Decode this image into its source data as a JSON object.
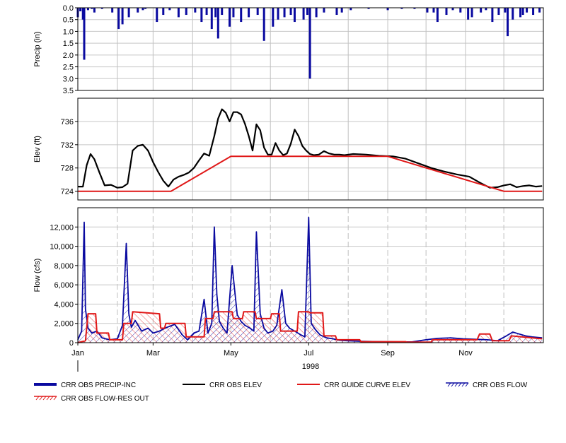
{
  "chart_data": [
    {
      "type": "bar",
      "panel": "precip",
      "ylabel": "Precip (in)",
      "ylim": [
        0,
        3.5
      ],
      "y_inverted": true,
      "y_ticks": [
        "0.0",
        "0.5",
        "1.0",
        "1.5",
        "2.0",
        "2.5",
        "3.0",
        "3.5"
      ],
      "y_tick_values": [
        0,
        0.5,
        1.0,
        1.5,
        2.0,
        2.5,
        3.0,
        3.5
      ],
      "series": [
        {
          "name": "CRR OBS PRECIP-INC",
          "color": "#0a0aa0",
          "x_dates": [
            "1998-01-01",
            "1998-01-03",
            "1998-01-05",
            "1998-01-06",
            "1998-01-09",
            "1998-01-12",
            "1998-01-14",
            "1998-01-20",
            "1998-01-28",
            "1998-02-02",
            "1998-02-05",
            "1998-02-10",
            "1998-02-17",
            "1998-02-21",
            "1998-02-23",
            "1998-03-04",
            "1998-03-09",
            "1998-03-14",
            "1998-03-21",
            "1998-03-27",
            "1998-04-03",
            "1998-04-08",
            "1998-04-12",
            "1998-04-16",
            "1998-04-19",
            "1998-04-21",
            "1998-04-24",
            "1998-04-30",
            "1998-05-03",
            "1998-05-09",
            "1998-05-15",
            "1998-05-22",
            "1998-05-27",
            "1998-06-03",
            "1998-06-07",
            "1998-06-12",
            "1998-06-17",
            "1998-06-20",
            "1998-06-27",
            "1998-06-30",
            "1998-07-02",
            "1998-07-07",
            "1998-07-13",
            "1998-07-23",
            "1998-07-27",
            "1998-08-03",
            "1998-08-17",
            "1998-09-01",
            "1998-09-12",
            "1998-09-22",
            "1998-10-02",
            "1998-10-07",
            "1998-10-10",
            "1998-10-17",
            "1998-10-22",
            "1998-10-28",
            "1998-11-03",
            "1998-11-06",
            "1998-11-13",
            "1998-11-17",
            "1998-11-22",
            "1998-11-27",
            "1998-12-02",
            "1998-12-04",
            "1998-12-08",
            "1998-12-14",
            "1998-12-16",
            "1998-12-19",
            "1998-12-24",
            "1998-12-29"
          ],
          "values": [
            0.4,
            0.15,
            0.5,
            2.2,
            0.1,
            0.05,
            0.2,
            0.05,
            0.2,
            0.9,
            0.7,
            0.4,
            0.2,
            0.1,
            0.05,
            0.6,
            0.3,
            0.1,
            0.4,
            0.3,
            0.2,
            0.6,
            0.3,
            0.9,
            0.4,
            1.3,
            0.3,
            0.8,
            0.4,
            0.6,
            0.4,
            0.3,
            1.4,
            0.8,
            0.5,
            0.4,
            0.3,
            0.6,
            0.5,
            0.3,
            3.0,
            0.4,
            0.2,
            0.3,
            0.2,
            0.1,
            0.05,
            0.1,
            0.05,
            0.05,
            0.2,
            0.2,
            0.6,
            0.3,
            0.1,
            0.2,
            0.5,
            0.4,
            0.2,
            0.1,
            0.6,
            0.3,
            0.2,
            1.2,
            0.5,
            0.4,
            0.3,
            0.2,
            0.3,
            0.2
          ]
        }
      ]
    },
    {
      "type": "line",
      "panel": "elev",
      "ylabel": "Elev (ft)",
      "ylim": [
        722.5,
        740
      ],
      "y_ticks": [
        "724",
        "728",
        "732",
        "736"
      ],
      "y_tick_values": [
        724,
        728,
        732,
        736
      ],
      "series": [
        {
          "name": "CRR OBS ELEV",
          "color": "#000000",
          "x_dates": [
            "1998-01-01",
            "1998-01-05",
            "1998-01-08",
            "1998-01-11",
            "1998-01-14",
            "1998-01-18",
            "1998-01-22",
            "1998-01-27",
            "1998-02-01",
            "1998-02-05",
            "1998-02-09",
            "1998-02-13",
            "1998-02-17",
            "1998-02-21",
            "1998-02-25",
            "1998-03-01",
            "1998-03-05",
            "1998-03-09",
            "1998-03-13",
            "1998-03-17",
            "1998-03-21",
            "1998-03-25",
            "1998-03-29",
            "1998-04-02",
            "1998-04-06",
            "1998-04-10",
            "1998-04-14",
            "1998-04-18",
            "1998-04-21",
            "1998-04-24",
            "1998-04-27",
            "1998-04-30",
            "1998-05-03",
            "1998-05-06",
            "1998-05-09",
            "1998-05-12",
            "1998-05-15",
            "1998-05-18",
            "1998-05-21",
            "1998-05-24",
            "1998-05-27",
            "1998-05-30",
            "1998-06-02",
            "1998-06-05",
            "1998-06-08",
            "1998-06-11",
            "1998-06-14",
            "1998-06-17",
            "1998-06-20",
            "1998-06-23",
            "1998-06-26",
            "1998-06-29",
            "1998-07-02",
            "1998-07-05",
            "1998-07-09",
            "1998-07-13",
            "1998-07-17",
            "1998-07-21",
            "1998-07-25",
            "1998-07-29",
            "1998-08-05",
            "1998-08-15",
            "1998-08-25",
            "1998-09-05",
            "1998-09-15",
            "1998-09-25",
            "1998-10-05",
            "1998-10-15",
            "1998-10-25",
            "1998-11-04",
            "1998-11-12",
            "1998-11-20",
            "1998-11-26",
            "1998-12-01",
            "1998-12-06",
            "1998-12-11",
            "1998-12-16",
            "1998-12-21",
            "1998-12-26",
            "1998-12-31"
          ],
          "values": [
            724.8,
            724.8,
            728.5,
            730.4,
            729.5,
            727.2,
            725.0,
            725.1,
            724.6,
            724.7,
            725.3,
            731.0,
            731.8,
            732.0,
            731.0,
            729.0,
            727.3,
            725.8,
            724.8,
            726.0,
            726.5,
            726.8,
            727.2,
            728.0,
            729.3,
            730.5,
            730.1,
            733.5,
            736.5,
            738.1,
            737.5,
            736.0,
            737.6,
            737.6,
            737.2,
            735.6,
            733.5,
            731.0,
            735.5,
            734.5,
            731.5,
            730.3,
            730.3,
            732.3,
            731.0,
            730.2,
            730.5,
            732.2,
            734.6,
            733.5,
            731.8,
            731.0,
            730.4,
            730.2,
            730.3,
            730.9,
            730.5,
            730.3,
            730.3,
            730.2,
            730.4,
            730.3,
            730.1,
            730.0,
            729.6,
            728.8,
            728.0,
            727.4,
            726.9,
            726.5,
            725.5,
            724.6,
            724.7,
            725.0,
            725.2,
            724.7,
            724.9,
            725.0,
            724.8,
            724.9
          ]
        },
        {
          "name": "CRR GUIDE CURVE ELEV",
          "color": "#e01818",
          "x_dates": [
            "1998-01-01",
            "1998-03-15",
            "1998-05-01",
            "1998-09-01",
            "1998-12-01",
            "1998-12-31"
          ],
          "values": [
            724.0,
            724.0,
            730.0,
            730.0,
            724.0,
            724.0
          ]
        }
      ]
    },
    {
      "type": "area",
      "panel": "flow",
      "ylabel": "Flow (cfs)",
      "ylim": [
        0,
        14000
      ],
      "y_ticks": [
        "0",
        "2,000",
        "4,000",
        "6,000",
        "8,000",
        "10,000",
        "12,000"
      ],
      "y_tick_values": [
        0,
        2000,
        4000,
        6000,
        8000,
        10000,
        12000
      ],
      "x_ticks": [
        "Jan",
        "Mar",
        "May",
        "Jul",
        "Sep",
        "Nov"
      ],
      "x_tick_dates": [
        "1998-01-01",
        "1998-03-01",
        "1998-05-01",
        "1998-07-01",
        "1998-09-01",
        "1998-11-01"
      ],
      "x_year_label": "1998",
      "series": [
        {
          "name": "CRR OBS FLOW",
          "color": "#0a0aa0",
          "x_dates": [
            "1998-01-01",
            "1998-01-04",
            "1998-01-06",
            "1998-01-07",
            "1998-01-09",
            "1998-01-12",
            "1998-01-16",
            "1998-01-20",
            "1998-01-26",
            "1998-02-01",
            "1998-02-05",
            "1998-02-08",
            "1998-02-10",
            "1998-02-12",
            "1998-02-15",
            "1998-02-20",
            "1998-02-25",
            "1998-03-01",
            "1998-03-06",
            "1998-03-12",
            "1998-03-18",
            "1998-03-24",
            "1998-03-28",
            "1998-04-02",
            "1998-04-06",
            "1998-04-10",
            "1998-04-13",
            "1998-04-16",
            "1998-04-18",
            "1998-04-20",
            "1998-04-22",
            "1998-04-25",
            "1998-04-28",
            "1998-05-02",
            "1998-05-06",
            "1998-05-09",
            "1998-05-12",
            "1998-05-16",
            "1998-05-19",
            "1998-05-21",
            "1998-05-24",
            "1998-05-27",
            "1998-05-30",
            "1998-06-03",
            "1998-06-06",
            "1998-06-10",
            "1998-06-13",
            "1998-06-16",
            "1998-06-20",
            "1998-06-25",
            "1998-06-28",
            "1998-07-01",
            "1998-07-03",
            "1998-07-06",
            "1998-07-10",
            "1998-07-15",
            "1998-07-20",
            "1998-07-25",
            "1998-08-01",
            "1998-08-10",
            "1998-08-20",
            "1998-08-30",
            "1998-09-10",
            "1998-09-20",
            "1998-10-01",
            "1998-10-10",
            "1998-10-20",
            "1998-10-30",
            "1998-11-08",
            "1998-11-18",
            "1998-11-26",
            "1998-12-03",
            "1998-12-08",
            "1998-12-13",
            "1998-12-18",
            "1998-12-23",
            "1998-12-31"
          ],
          "values": [
            300,
            1200,
            12500,
            3500,
            1500,
            1000,
            1200,
            500,
            300,
            400,
            1800,
            10300,
            3000,
            1600,
            2300,
            1200,
            1500,
            1000,
            1200,
            1600,
            1900,
            800,
            300,
            1000,
            1200,
            4500,
            1000,
            2000,
            12000,
            5000,
            2200,
            1500,
            1000,
            8000,
            2900,
            2200,
            1800,
            1500,
            1200,
            11500,
            3000,
            1500,
            1000,
            1200,
            1800,
            5500,
            2000,
            1500,
            1200,
            800,
            600,
            13000,
            2000,
            1400,
            800,
            500,
            400,
            250,
            200,
            150,
            120,
            100,
            80,
            80,
            300,
            450,
            500,
            400,
            350,
            300,
            200,
            700,
            1100,
            900,
            700,
            600,
            500
          ]
        },
        {
          "name": "CRR OBS FLOW-RES OUT",
          "color": "#e01818",
          "x_dates": [
            "1998-01-01",
            "1998-01-07",
            "1998-01-09",
            "1998-01-15",
            "1998-01-16",
            "1998-01-25",
            "1998-01-26",
            "1998-02-05",
            "1998-02-06",
            "1998-02-12",
            "1998-02-13",
            "1998-03-06",
            "1998-03-07",
            "1998-03-10",
            "1998-03-11",
            "1998-03-26",
            "1998-03-27",
            "1998-04-10",
            "1998-04-11",
            "1998-04-17",
            "1998-04-18",
            "1998-05-02",
            "1998-05-03",
            "1998-05-10",
            "1998-05-11",
            "1998-05-20",
            "1998-05-21",
            "1998-06-01",
            "1998-06-02",
            "1998-06-08",
            "1998-06-09",
            "1998-06-22",
            "1998-06-23",
            "1998-07-01",
            "1998-07-02",
            "1998-07-12",
            "1998-07-13",
            "1998-07-22",
            "1998-07-23",
            "1998-08-10",
            "1998-08-11",
            "1998-09-15",
            "1998-09-16",
            "1998-10-05",
            "1998-10-06",
            "1998-11-10",
            "1998-11-12",
            "1998-11-20",
            "1998-11-22",
            "1998-12-05",
            "1998-12-07",
            "1998-12-31"
          ],
          "values": [
            0,
            200,
            3000,
            3000,
            1000,
            1000,
            300,
            300,
            2000,
            2000,
            3200,
            3000,
            1500,
            1500,
            2000,
            2000,
            600,
            600,
            2500,
            2500,
            3200,
            3200,
            2500,
            2500,
            3200,
            3200,
            2500,
            2500,
            3000,
            3000,
            1200,
            1200,
            3200,
            3200,
            3100,
            3100,
            700,
            700,
            300,
            300,
            100,
            100,
            50,
            50,
            300,
            300,
            900,
            900,
            200,
            200,
            700,
            400
          ]
        }
      ]
    }
  ],
  "legend": {
    "items": [
      {
        "label": "CRR OBS PRECIP-INC",
        "style": "thick-bar",
        "color": "#0a0aa0"
      },
      {
        "label": "CRR OBS ELEV",
        "style": "line",
        "color": "#000000"
      },
      {
        "label": "CRR GUIDE CURVE ELEV",
        "style": "line",
        "color": "#e01818"
      },
      {
        "label": "CRR OBS FLOW",
        "style": "hatch-line",
        "color": "#0a0aa0"
      },
      {
        "label": "CRR OBS FLOW-RES OUT",
        "style": "hatch-line",
        "color": "#e01818"
      }
    ]
  }
}
